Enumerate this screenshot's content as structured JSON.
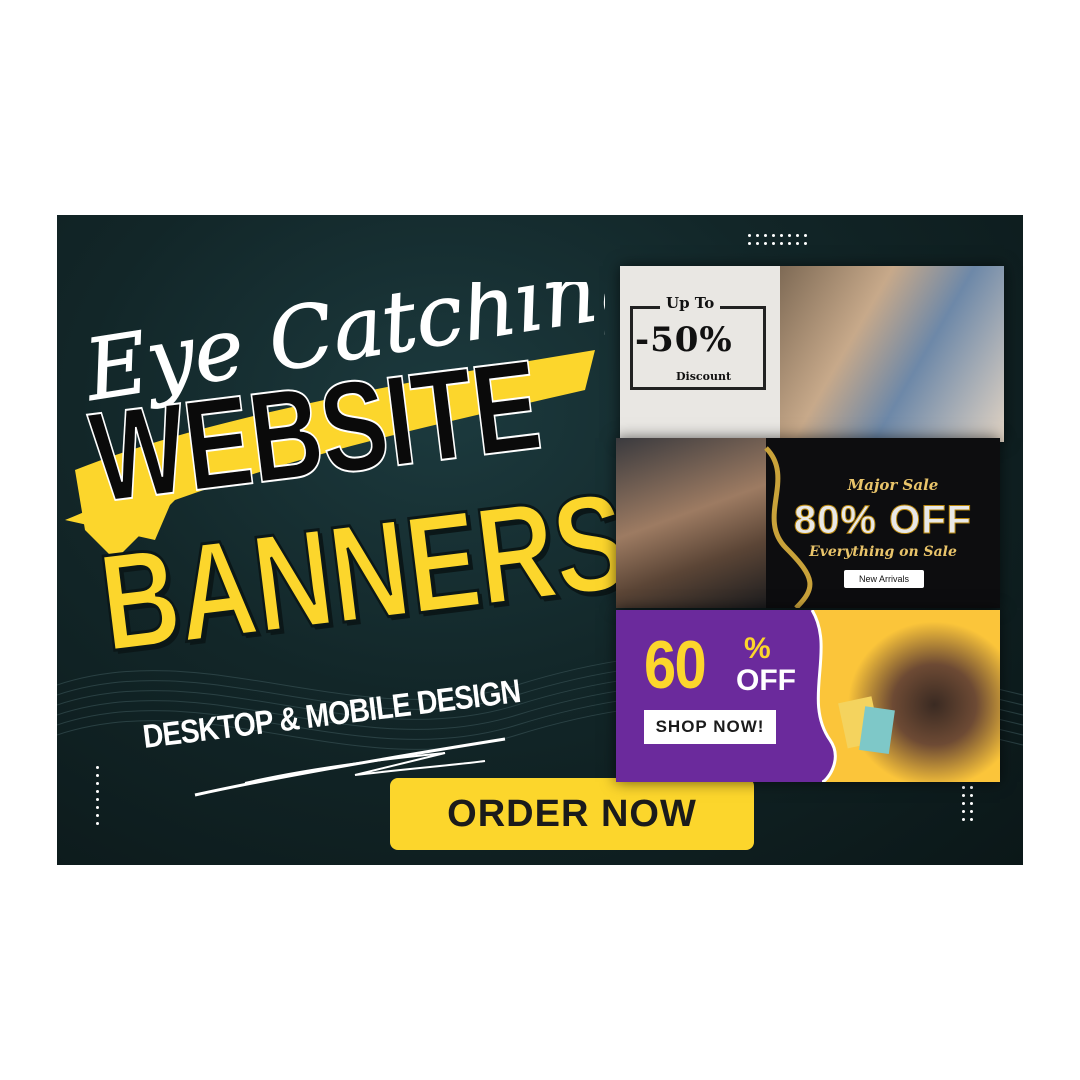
{
  "script_title": "Eye Catching",
  "headline": {
    "line1": "WEBSITE",
    "line2": "BANNERS",
    "subtitle": "DESKTOP & MOBILE DESIGN"
  },
  "cta": {
    "label": "ORDER NOW"
  },
  "banners": [
    {
      "top_text": "Up To",
      "value": "-50%",
      "bottom_text": "Discount"
    },
    {
      "top_text": "Major Sale",
      "value": "80% OFF",
      "bottom_text": "Everything on Sale",
      "button": "New Arrivals"
    },
    {
      "value": "60",
      "percent": "%",
      "off": "OFF",
      "button": "SHOP NOW!"
    }
  ],
  "colors": {
    "background": "#ffffff",
    "poster": "#122628",
    "accent_yellow": "#fcd62c",
    "purple": "#6b2a9c",
    "gold": "#e9c46a"
  }
}
